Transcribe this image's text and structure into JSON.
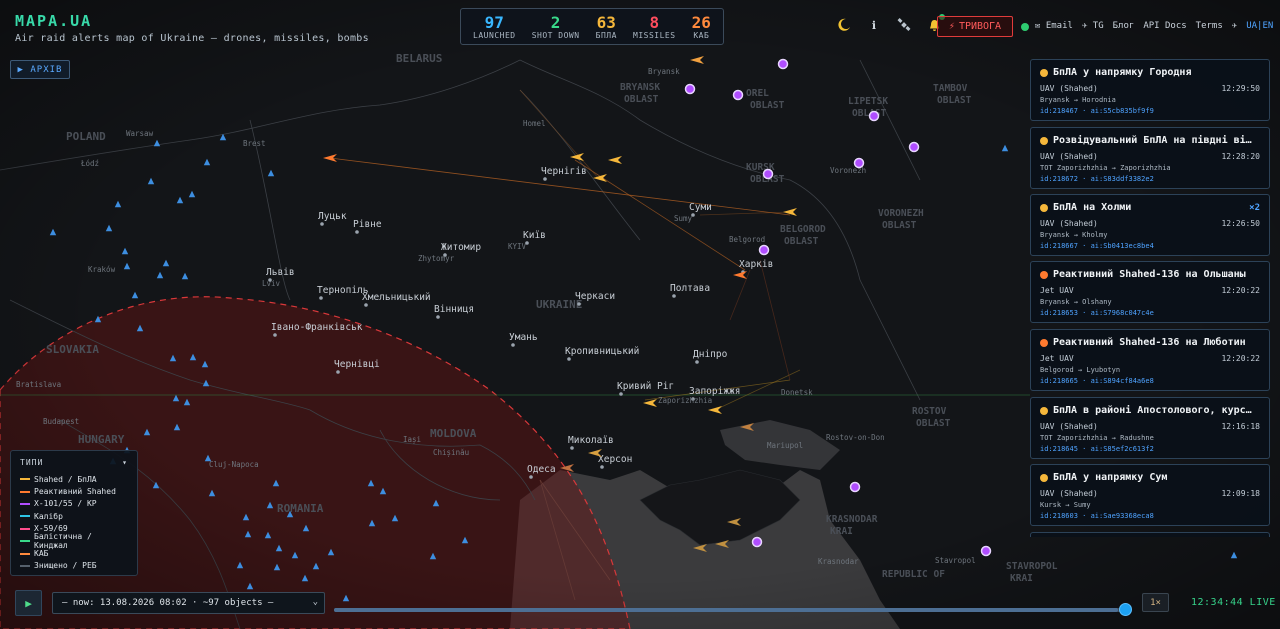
{
  "brand": {
    "title": "MAPA.UA",
    "subtitle": "Air raid alerts map of Ukraine — drones, missiles, bombs"
  },
  "stats": [
    {
      "value": "97",
      "label": "LAUNCHED",
      "color": "#39b7ff"
    },
    {
      "value": "2",
      "label": "SHOT DOWN",
      "color": "#39d98a"
    },
    {
      "value": "63",
      "label": "БПЛА",
      "color": "#f5b73b"
    },
    {
      "value": "8",
      "label": "MISSILES",
      "color": "#ff4d5e"
    },
    {
      "value": "26",
      "label": "КАБ",
      "color": "#ff8a3d"
    }
  ],
  "header": {
    "icons": [
      "moon-icon",
      "info-icon",
      "satellite-icon",
      "bell-icon"
    ],
    "alarm_label": "ТРИВОГА",
    "links": [
      "✉ Email",
      "✈ TG",
      "Блог",
      "API Docs",
      "Terms",
      "✈"
    ],
    "lang": "UA|EN"
  },
  "archive_label": "▶ АРХІВ",
  "alerts": [
    {
      "title": "БпЛА у напрямку Городня",
      "type": "UAV (Shahed)",
      "time": "12:29:50",
      "route": "Bryansk → Horodnia",
      "id": "id:218467 · ai:S5cb835bf9f9",
      "dot": "#f5b73b",
      "mult": ""
    },
    {
      "title": "Розвідувальний БпЛА на півдні від З…",
      "type": "UAV (Shahed)",
      "time": "12:28:20",
      "route": "TOT Zaporizhzhia → Zaporizhzhia",
      "id": "id:218672 · ai:S83ddf3382e2",
      "dot": "#f5b73b",
      "mult": ""
    },
    {
      "title": "БпЛА на Холми",
      "type": "UAV (Shahed)",
      "time": "12:26:50",
      "route": "Bryansk → Kholmy",
      "id": "id:218667 · ai:Sb0413ec8be4",
      "dot": "#f5b73b",
      "mult": "×2"
    },
    {
      "title": "Реактивний Shahed-136 на Ольшаны",
      "type": "Jet UAV",
      "time": "12:20:22",
      "route": "Bryansk → Olshany",
      "id": "id:218653 · ai:S7968c047c4e",
      "dot": "#ff7a2f",
      "mult": ""
    },
    {
      "title": "Реактивний Shahed-136 на Люботин",
      "type": "Jet UAV",
      "time": "12:20:22",
      "route": "Belgorod → Lyubotyn",
      "id": "id:218665 · ai:S894cf84a6e8",
      "dot": "#ff7a2f",
      "mult": ""
    },
    {
      "title": "БпЛА в районі Апостолового, курс у …",
      "type": "UAV (Shahed)",
      "time": "12:16:18",
      "route": "TOT Zaporizhzhia → Radushne",
      "id": "id:218645 · ai:S85ef2c613f2",
      "dot": "#f5b73b",
      "mult": ""
    },
    {
      "title": "БпЛА у напрямку Сум",
      "type": "UAV (Shahed)",
      "time": "12:09:18",
      "route": "Kursk → Sumy",
      "id": "id:218603 · ai:Sae93368eca8",
      "dot": "#f5b73b",
      "mult": ""
    }
  ],
  "legend": {
    "title": "ТИПИ",
    "items": [
      {
        "label": "Shahed / БпЛА",
        "color": "#f5b73b"
      },
      {
        "label": "Реактивний Shahed",
        "color": "#ff7a2f"
      },
      {
        "label": "Х-101/55 / КР",
        "color": "#b04dff"
      },
      {
        "label": "Калібр",
        "color": "#2ec4e6"
      },
      {
        "label": "Х-59/69",
        "color": "#ff4d8d"
      },
      {
        "label": "Балістична / Кинджал",
        "color": "#39d98a"
      },
      {
        "label": "КАБ",
        "color": "#ff8a3d"
      },
      {
        "label": "Знищено / РЕБ",
        "color": "#55606c"
      }
    ]
  },
  "timeline": {
    "play_icon": "▶",
    "select_value": "— now: 13.08.2026 08:02 · ~97 objects —",
    "progress": 0.99,
    "speed": "1×",
    "clock": "12:34:44 LIVE"
  },
  "map": {
    "countries": [
      "BELARUS",
      "POLAND",
      "SLOVAKIA",
      "HUNGARY",
      "ROMANIA",
      "MOLDOVA",
      "UKRAINE"
    ],
    "regions": [
      "BRYANSK OBLAST",
      "OREL OBLAST",
      "LIPETSK OBLAST",
      "TAMBOV OBLAST",
      "KURSK OBLAST",
      "BELGOROD OBLAST",
      "VORONEZH OBLAST",
      "ROSTOV OBLAST",
      "KRASNODAR KRAI",
      "STAVROPOL KRAI",
      "REPUBLIC OF"
    ],
    "cities_ua": [
      "Чернігів",
      "Суми",
      "Луцьк",
      "Рівне",
      "Житомир",
      "Київ",
      "Харків",
      "Львів",
      "Тернопіль",
      "Хмельницький",
      "Вінниця",
      "Черкаси",
      "Полтава",
      "Івано-Франківськ",
      "Умань",
      "Кропивницький",
      "Чернівці",
      "Дніпро",
      "Кривий Ріг",
      "Запоріжжя",
      "Миколаїв",
      "Херсон",
      "Одеса"
    ],
    "cities_small": [
      "Bryansk",
      "Homel",
      "Brest",
      "Warsaw",
      "Łódź",
      "Kraków",
      "Zhytomyr",
      "KYIV",
      "Sumy",
      "Belgorod",
      "Lviv",
      "Zaporizhzhia",
      "Donetsk",
      "Rostov-on-Don",
      "Mariupol",
      "Krasnodar",
      "Stavropol",
      "Budapest",
      "Bratislava",
      "Cluj-Napoca",
      "Iași",
      "Chișinău",
      "Voronezh"
    ]
  }
}
